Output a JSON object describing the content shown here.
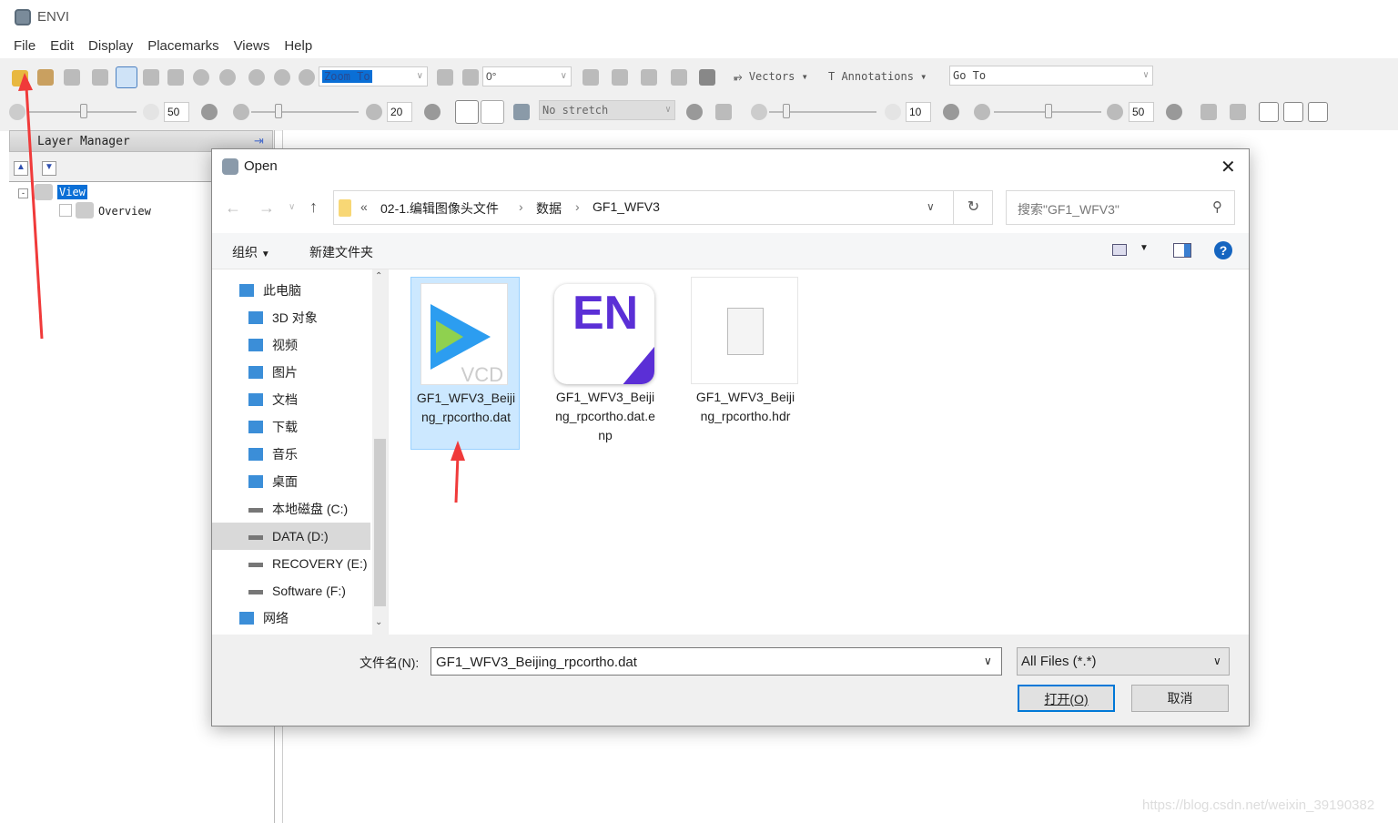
{
  "app": {
    "title": "ENVI",
    "menu": [
      "File",
      "Edit",
      "Display",
      "Placemarks",
      "Views",
      "Help"
    ]
  },
  "toolbar": {
    "zoom_to": "Zoom To",
    "rotation": "0°",
    "vectors": "Vectors",
    "annotations": "Annotations",
    "go_to": "Go To",
    "brightness": "50",
    "contrast": "20",
    "stretch": "No stretch",
    "sharpen": "10",
    "transparency": "50"
  },
  "layer_manager": {
    "title": "Layer Manager",
    "view": "View",
    "overview": "Overview"
  },
  "dialog": {
    "title": "Open",
    "breadcrumb": [
      "02-1.编辑图像头文件",
      "数据",
      "GF1_WFV3"
    ],
    "breadcrumb_prefix": "«",
    "search_placeholder": "搜索\"GF1_WFV3\"",
    "organize": "组织",
    "new_folder": "新建文件夹",
    "nav": [
      {
        "label": "此电脑",
        "icon": "computer-icon",
        "level": 0
      },
      {
        "label": "3D 对象",
        "icon": "cube-icon",
        "level": 1
      },
      {
        "label": "视频",
        "icon": "video-icon",
        "level": 1
      },
      {
        "label": "图片",
        "icon": "picture-icon",
        "level": 1
      },
      {
        "label": "文档",
        "icon": "document-icon",
        "level": 1
      },
      {
        "label": "下载",
        "icon": "download-icon",
        "level": 1
      },
      {
        "label": "音乐",
        "icon": "music-icon",
        "level": 1
      },
      {
        "label": "桌面",
        "icon": "desktop-icon",
        "level": 1
      },
      {
        "label": "本地磁盘 (C:)",
        "icon": "drive-icon",
        "level": 1
      },
      {
        "label": "DATA (D:)",
        "icon": "drive-icon",
        "level": 1,
        "selected": true
      },
      {
        "label": "RECOVERY (E:)",
        "icon": "drive-icon",
        "level": 1
      },
      {
        "label": "Software (F:)",
        "icon": "drive-icon",
        "level": 1
      },
      {
        "label": "网络",
        "icon": "network-icon",
        "level": 0
      }
    ],
    "files": [
      {
        "name": "GF1_WFV3_Beijing_rpcortho.dat",
        "icon": "vcd-video-file-icon",
        "badge": "VCD",
        "selected": true
      },
      {
        "name": "GF1_WFV3_Beijing_rpcortho.dat.enp",
        "icon": "envi-en-icon",
        "badge": "EN"
      },
      {
        "name": "GF1_WFV3_Beijing_rpcortho.hdr",
        "icon": "blank-file-icon"
      }
    ],
    "filename_label": "文件名(N):",
    "filename_value": "GF1_WFV3_Beijing_rpcortho.dat",
    "filter": "All Files (*.*)",
    "open_button": "打开(O)",
    "cancel_button": "取消"
  },
  "watermark": "https://blog.csdn.net/weixin_39190382",
  "colors": {
    "selection": "#cce8ff",
    "accent": "#0078d7",
    "arrow": "#f03a3a",
    "envi_purple": "#5b2fd6"
  }
}
